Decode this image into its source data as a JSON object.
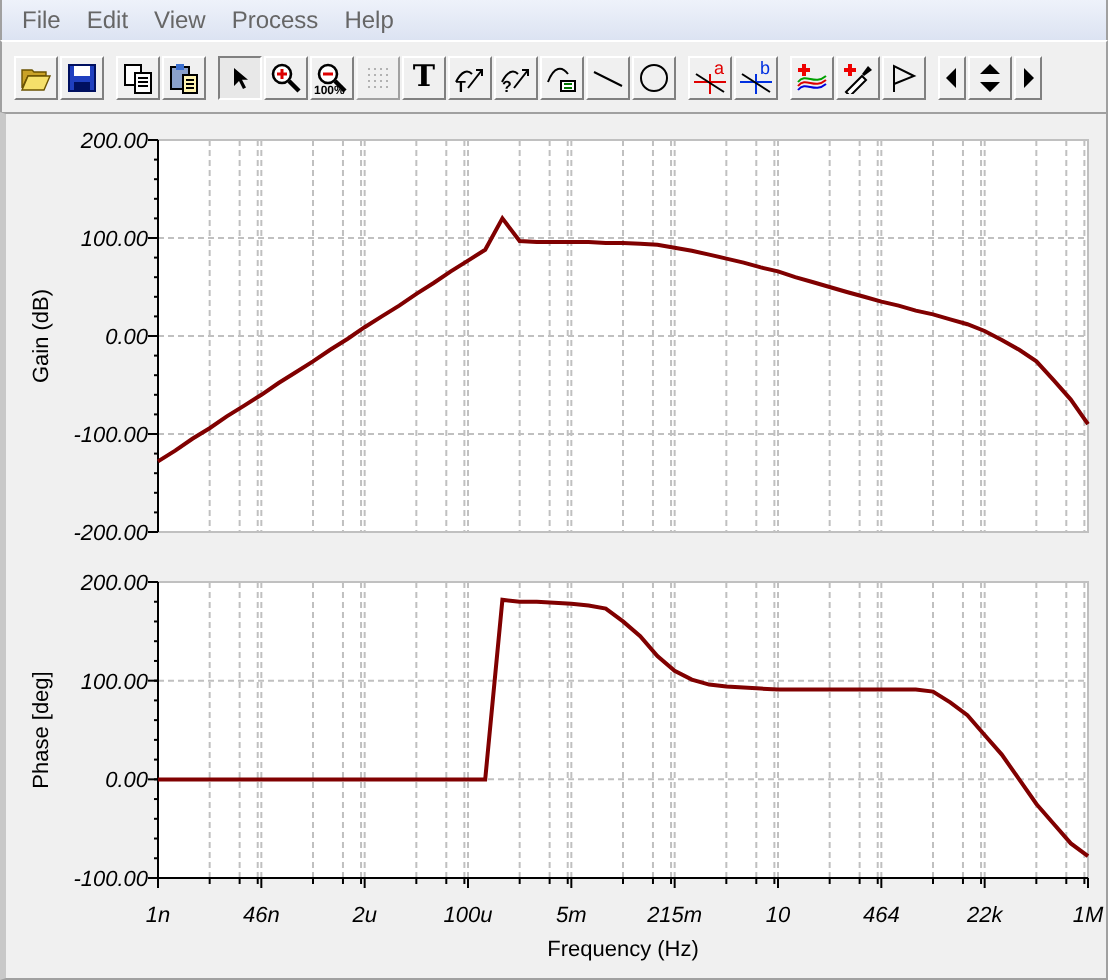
{
  "menu": [
    "File",
    "Edit",
    "View",
    "Process",
    "Help"
  ],
  "toolbar": [
    [
      {
        "kind": "open"
      },
      {
        "kind": "save"
      }
    ],
    [
      {
        "kind": "copy"
      },
      {
        "kind": "paste"
      }
    ],
    [
      {
        "kind": "pointer",
        "selected": true
      },
      {
        "kind": "zoom-in",
        "selected": false
      },
      {
        "kind": "zoom-out",
        "label": "100%",
        "selected": false
      },
      {
        "kind": "grid",
        "disabled": true
      },
      {
        "kind": "text",
        "label": "T"
      },
      {
        "kind": "marker-t",
        "label": "T"
      },
      {
        "kind": "marker-q",
        "label": "?"
      },
      {
        "kind": "marker-x"
      },
      {
        "kind": "line"
      },
      {
        "kind": "circle"
      }
    ],
    [
      {
        "kind": "cursor-a",
        "label": "a"
      },
      {
        "kind": "cursor-b",
        "label": "b"
      }
    ],
    [
      {
        "kind": "add-curve"
      },
      {
        "kind": "add-pick"
      },
      {
        "kind": "flag"
      }
    ],
    [
      {
        "kind": "arrow-left"
      },
      {
        "kind": "arrow-updown"
      },
      {
        "kind": "arrow-right"
      }
    ]
  ],
  "charts": [
    {
      "chart_data": {
        "type": "line",
        "ylabel": "Gain (dB)",
        "grid": true,
        "ylim": [
          -200,
          200
        ],
        "yticks": [
          {
            "value": 200,
            "label": "200.00"
          },
          {
            "value": 100,
            "label": "100.00"
          },
          {
            "value": 0,
            "label": "0.00"
          },
          {
            "value": -100,
            "label": "-100.00"
          },
          {
            "value": -200,
            "label": "-200.00"
          }
        ],
        "series": [
          {
            "color": "#800000",
            "values": [
              -128,
              -117,
              -105,
              -94,
              -82,
              -71,
              -60,
              -48,
              -37,
              -26,
              -14,
              -3,
              9,
              20,
              31,
              43,
              54,
              66,
              77,
              88,
              120,
              97,
              96,
              96,
              96,
              96,
              95,
              95,
              94,
              93,
              90,
              87,
              83,
              79,
              75,
              70,
              66,
              60,
              55,
              50,
              45,
              40,
              35,
              31,
              26,
              22,
              17,
              12,
              5,
              -4,
              -14,
              -26,
              -45,
              -65,
              -90
            ]
          }
        ]
      }
    },
    {
      "chart_data": {
        "type": "line",
        "ylabel": "Phase [deg]",
        "xlabel": "Frequency (Hz)",
        "grid": true,
        "ylim": [
          -100,
          200
        ],
        "categories": [
          "1n",
          null,
          null,
          null,
          null,
          null,
          "46n",
          null,
          null,
          null,
          null,
          null,
          "2u",
          null,
          null,
          null,
          null,
          null,
          "100u",
          null,
          null,
          null,
          null,
          null,
          "5m",
          null,
          null,
          null,
          null,
          null,
          "215m",
          null,
          null,
          null,
          null,
          null,
          "10",
          null,
          null,
          null,
          null,
          null,
          "464",
          null,
          null,
          null,
          null,
          null,
          "22k",
          null,
          null,
          null,
          null,
          null,
          "1M"
        ],
        "yticks": [
          {
            "value": 200,
            "label": "200.00"
          },
          {
            "value": 100,
            "label": "100.00"
          },
          {
            "value": 0,
            "label": "0.00"
          },
          {
            "value": -100,
            "label": "-100.00"
          }
        ],
        "series": [
          {
            "color": "#800000",
            "values": [
              0,
              0,
              0,
              0,
              0,
              0,
              0,
              0,
              0,
              0,
              0,
              0,
              0,
              0,
              0,
              0,
              0,
              0,
              0,
              0,
              182,
              180,
              180,
              179,
              178,
              176,
              173,
              160,
              145,
              125,
              110,
              101,
              96,
              94,
              93,
              92,
              91,
              91,
              91,
              91,
              91,
              91,
              91,
              91,
              91,
              89,
              78,
              65,
              45,
              25,
              0,
              -25,
              -45,
              -65,
              -78
            ]
          }
        ]
      }
    }
  ]
}
